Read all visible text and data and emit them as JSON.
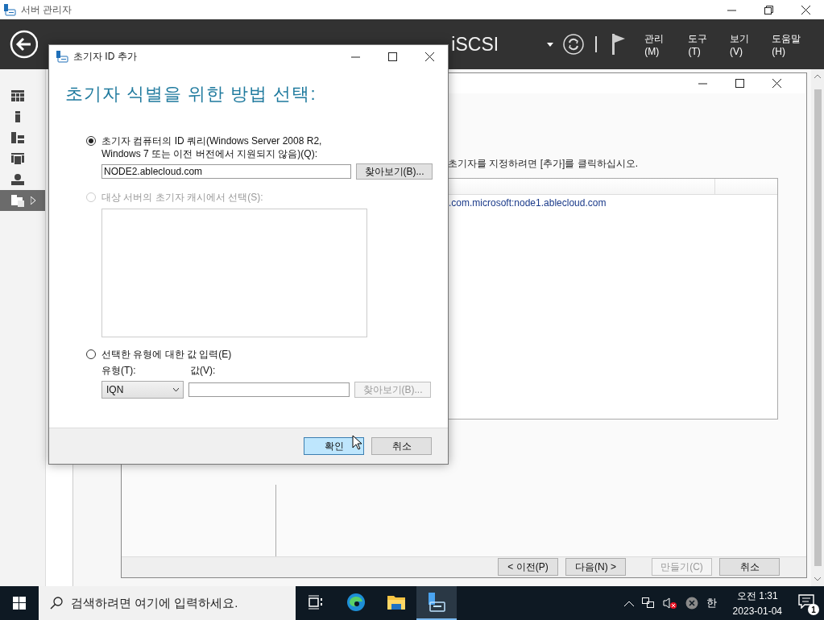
{
  "app": {
    "title": "서버 관리자"
  },
  "header": {
    "breadcrumb": "iSCSI",
    "menus": [
      "관리(M)",
      "도구(T)",
      "보기(V)",
      "도움말(H)"
    ]
  },
  "sidebar": {
    "items": [
      {
        "selected": false
      },
      {
        "selected": false
      },
      {
        "selected": false
      },
      {
        "selected": false
      },
      {
        "selected": false
      },
      {
        "selected": true
      }
    ]
  },
  "wizard": {
    "instruction": "초기자를 지정하려면 [추가]를 클릭하십시오.",
    "rows": [
      ".com.microsoft:node1.ablecloud.com"
    ],
    "buttons": [
      {
        "label": "< 이전(P)",
        "disabled": false
      },
      {
        "label": "다음(N) >",
        "disabled": false
      },
      {
        "label": "만들기(C)",
        "disabled": true
      },
      {
        "label": "취소",
        "disabled": false
      }
    ]
  },
  "dialog": {
    "title": "초기자 ID 추가",
    "heading": "초기자 식별을 위한 방법 선택:",
    "query_option": {
      "label": "초기자 컴퓨터의 ID 쿼리(Windows Server 2008 R2, Windows 7 또는 이전 버전에서 지원되지 않음)(Q):",
      "selected": true,
      "value": "NODE2.ablecloud.com",
      "browse": {
        "label": "찾아보기(B)...",
        "disabled": false
      }
    },
    "cache_option": {
      "label": "대상 서버의 초기자 캐시에서 선택(S):",
      "selected": false,
      "disabled": true
    },
    "manual_option": {
      "label": "선택한 유형에 대한 값 입력(E)",
      "selected": false,
      "type_label": "유형(T):",
      "type_value": "IQN",
      "value_label": "값(V):",
      "browse": {
        "label": "찾아보기(B)...",
        "disabled": true
      }
    },
    "buttons": [
      {
        "label": "확인",
        "highlighted": true
      },
      {
        "label": "취소",
        "highlighted": false
      }
    ]
  },
  "taskbar": {
    "search_placeholder": "검색하려면 여기에 입력하세요.",
    "apps": [
      {
        "kind": "taskview",
        "selected": false
      },
      {
        "kind": "edge",
        "selected": false
      },
      {
        "kind": "explorer",
        "selected": false
      },
      {
        "kind": "servermanager",
        "selected": true
      }
    ],
    "ime": "한",
    "time": "오전 1:31",
    "date": "2023-01-04",
    "notifications": "1"
  }
}
